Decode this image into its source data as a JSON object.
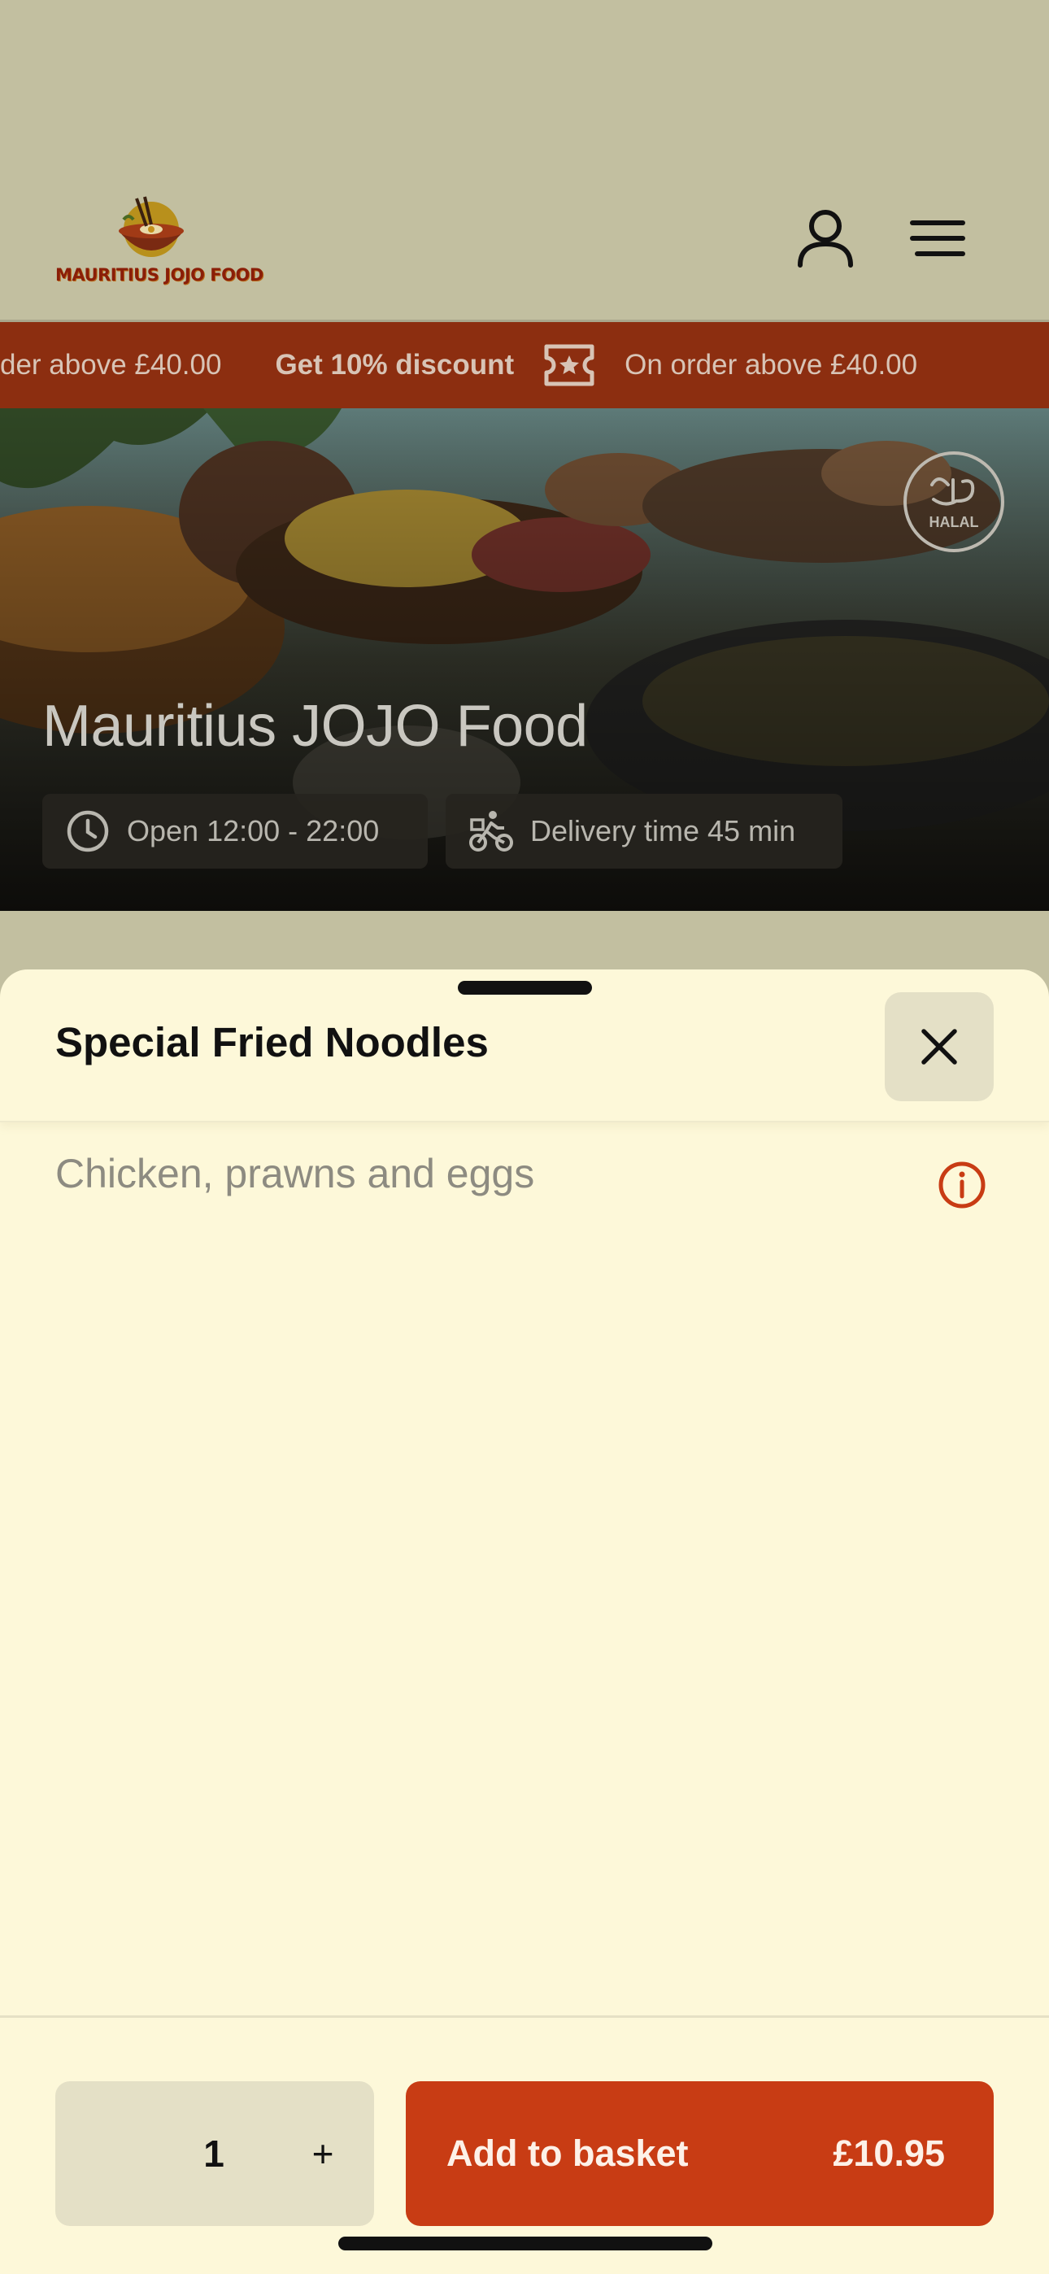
{
  "header": {
    "logo_text": "MAURITIUS JOJO FOOD",
    "icons": [
      "user-icon",
      "menu-icon"
    ]
  },
  "promo": {
    "left_fragment": "der above £40.00",
    "discount": "Get 10% discount",
    "condition": "On order above £40.00",
    "icon": "ticket-icon"
  },
  "hero": {
    "title": "Mauritius JOJO Food",
    "open_hours": "Open 12:00 - 22:00",
    "delivery_time": "Delivery time 45 min",
    "badge": "HALAL"
  },
  "item": {
    "title": "Special Fried Noodles",
    "description": "Chicken, prawns and eggs"
  },
  "footer": {
    "quantity": "1",
    "plus_label": "+",
    "add_label": "Add to basket",
    "price": "£10.95"
  },
  "colors": {
    "accent": "#c83c14",
    "sheet_bg": "#fdf8d9",
    "promo_bg": "#8c2e10"
  }
}
